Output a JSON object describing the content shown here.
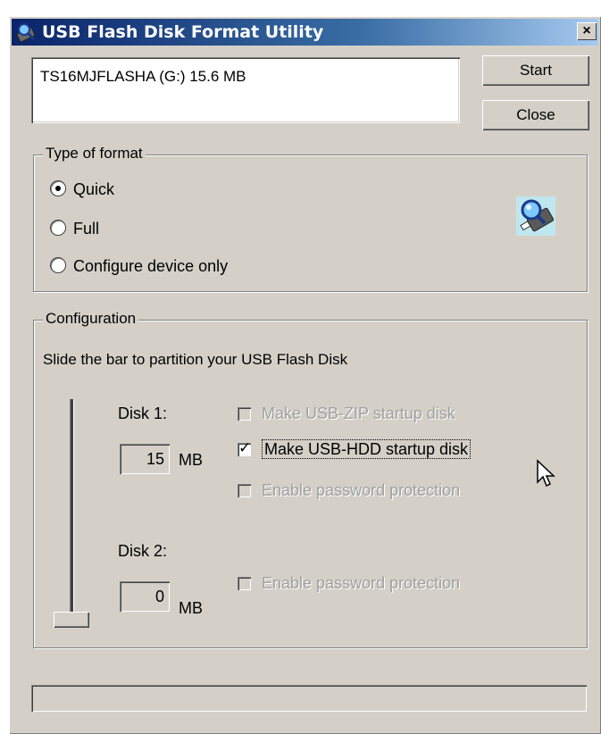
{
  "window": {
    "title": "USB Flash Disk Format Utility",
    "close_glyph": "×"
  },
  "device_list": {
    "items": [
      "TS16MJFLASHA (G:)  15.6 MB"
    ]
  },
  "buttons": {
    "start": "Start",
    "close": "Close"
  },
  "format_type": {
    "label": "Type of format",
    "options": [
      {
        "label": "Quick",
        "selected": true
      },
      {
        "label": "Full",
        "selected": false
      },
      {
        "label": "Configure device only",
        "selected": false
      }
    ]
  },
  "configuration": {
    "label": "Configuration",
    "instruction": "Slide the bar to partition your USB Flash Disk",
    "disk1": {
      "label": "Disk 1:",
      "size": "15",
      "unit": "MB",
      "options": [
        {
          "label": "Make USB-ZIP startup disk",
          "checked": false,
          "enabled": false
        },
        {
          "label": "Make USB-HDD startup disk",
          "checked": true,
          "enabled": true
        },
        {
          "label": "Enable password protection",
          "checked": false,
          "enabled": false
        }
      ]
    },
    "disk2": {
      "label": "Disk 2:",
      "size": "0",
      "unit": "MB",
      "options": [
        {
          "label": "Enable password protection",
          "checked": false,
          "enabled": false
        }
      ]
    }
  },
  "colors": {
    "face": "#d4d0c8",
    "title_start": "#0a246a",
    "title_end": "#a6caf0",
    "disabled_text": "#a0a0a0"
  }
}
